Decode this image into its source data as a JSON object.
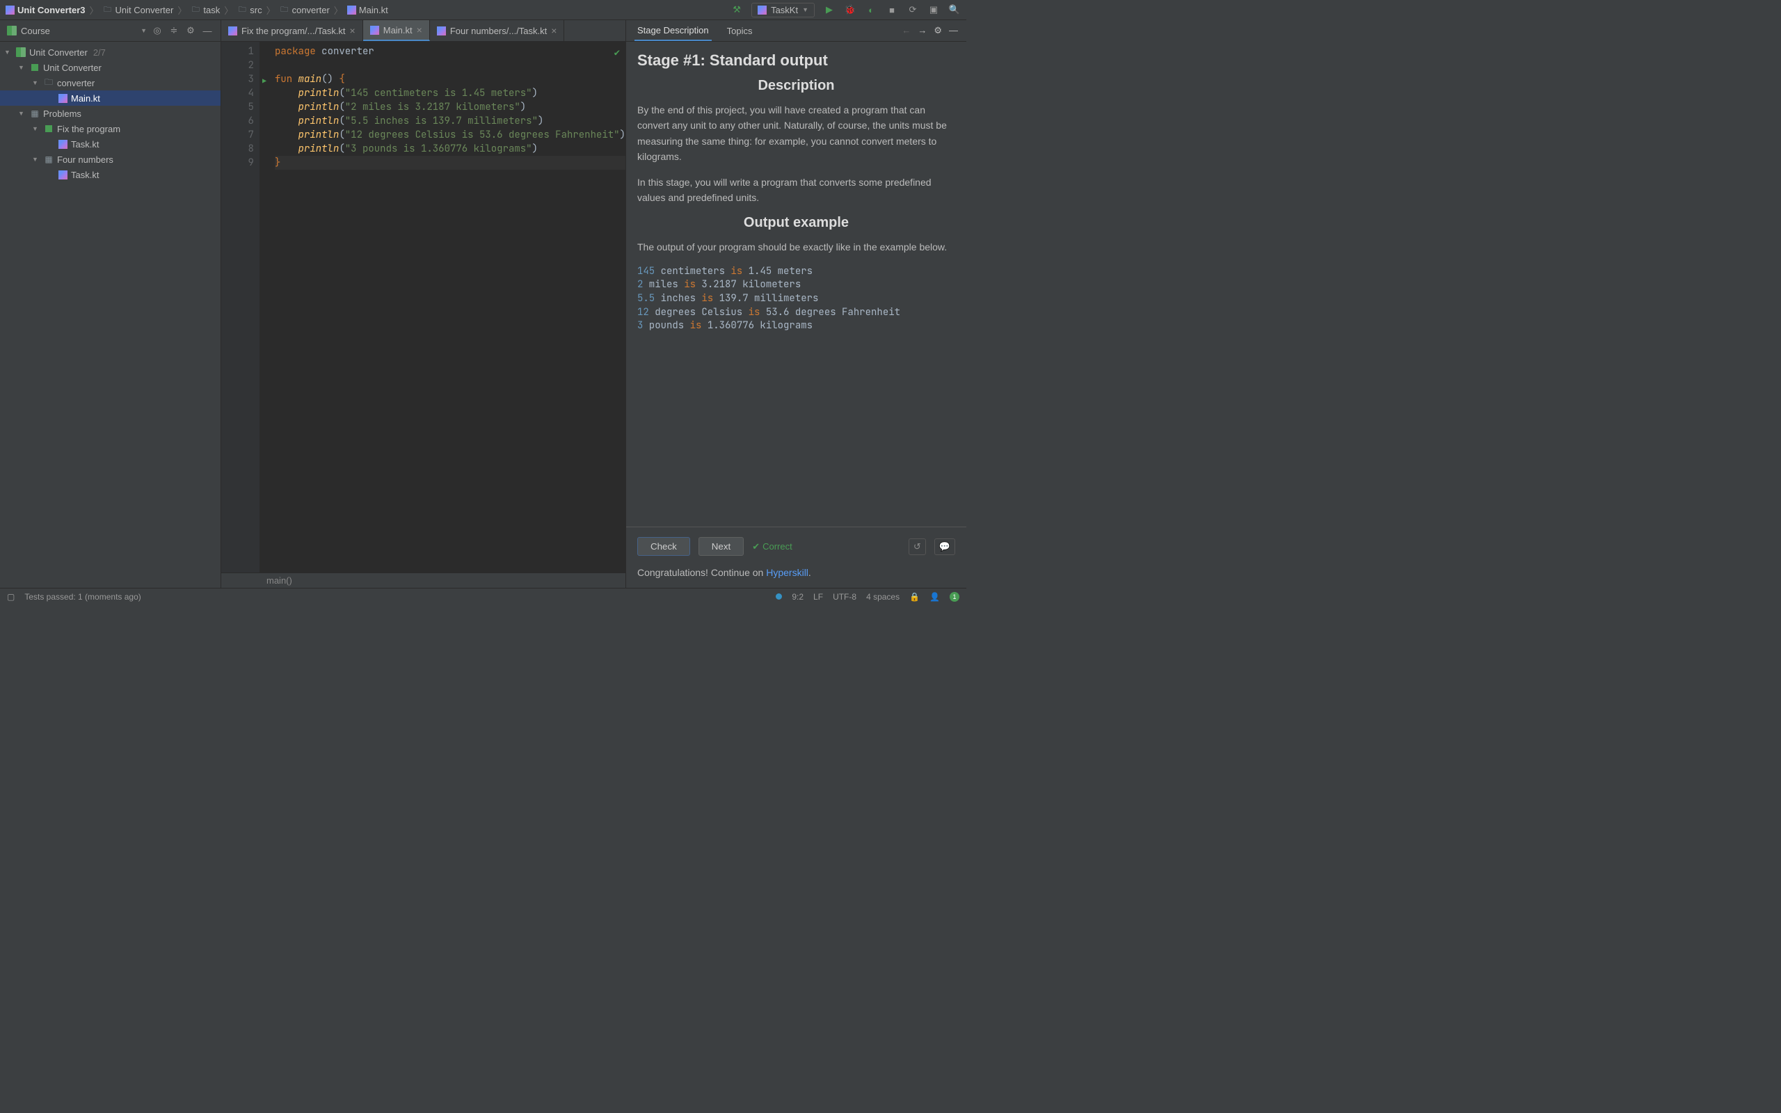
{
  "breadcrumbs": [
    {
      "label": "Unit Converter3",
      "bold": true
    },
    {
      "label": "Unit Converter"
    },
    {
      "label": "task"
    },
    {
      "label": "src"
    },
    {
      "label": "converter"
    },
    {
      "label": "Main.kt"
    }
  ],
  "run_config": "TaskKt",
  "sidebar": {
    "title": "Course",
    "tree": [
      {
        "depth": 0,
        "arrow": "▼",
        "icon": "book",
        "label": "Unit Converter",
        "count": "2/7"
      },
      {
        "depth": 1,
        "arrow": "▼",
        "icon": "green",
        "label": "Unit Converter"
      },
      {
        "depth": 2,
        "arrow": "▼",
        "icon": "folder",
        "label": "converter"
      },
      {
        "depth": 3,
        "arrow": "",
        "icon": "kotlin",
        "label": "Main.kt",
        "selected": true
      },
      {
        "depth": 1,
        "arrow": "▼",
        "icon": "module",
        "label": "Problems"
      },
      {
        "depth": 2,
        "arrow": "▼",
        "icon": "green",
        "label": "Fix the program"
      },
      {
        "depth": 3,
        "arrow": "",
        "icon": "kotlin",
        "label": "Task.kt"
      },
      {
        "depth": 2,
        "arrow": "▼",
        "icon": "module",
        "label": "Four numbers"
      },
      {
        "depth": 3,
        "arrow": "",
        "icon": "kotlin",
        "label": "Task.kt"
      }
    ]
  },
  "tabs": [
    {
      "label": "Fix the program/.../Task.kt"
    },
    {
      "label": "Main.kt",
      "active": true
    },
    {
      "label": "Four numbers/.../Task.kt"
    }
  ],
  "code": {
    "package_kw": "package",
    "package_name": " converter",
    "fun_kw": "fun",
    "main_name": " main",
    "parens": "() ",
    "lbrace": "{",
    "println": "println",
    "strings": [
      "\"145 centimeters is 1.45 meters\"",
      "\"2 miles is 3.2187 kilometers\"",
      "\"5.5 inches is 139.7 millimeters\"",
      "\"12 degrees Celsius is 53.6 degrees Fahrenheit\"",
      "\"3 pounds is 1.360776 kilograms\""
    ],
    "rbrace": "}"
  },
  "editor_footer": "main()",
  "desc": {
    "tab1": "Stage Description",
    "tab2": "Topics",
    "title": "Stage #1: Standard output",
    "h_desc": "Description",
    "p1": "By the end of this project, you will have created a program that can convert any unit to any other unit. Naturally, of course, the units must be measuring the same thing: for example, you cannot convert meters to kilograms.",
    "p2": "In this stage, you will write a program that converts some predefined values and predefined units.",
    "h_out": "Output example",
    "p3": "The output of your program should be exactly like in the example below.",
    "example": [
      {
        "n": "145",
        "t": " centimeters ",
        "k": "is",
        "rest": " 1.45 meters"
      },
      {
        "n": "2",
        "t": " miles ",
        "k": "is",
        "rest": " 3.2187 kilometers"
      },
      {
        "n": "5.5",
        "t": " inches ",
        "k": "is",
        "rest": " 139.7 millimeters"
      },
      {
        "n": "12",
        "t": " degrees Celsius ",
        "k": "is",
        "rest": " 53.6 degrees Fahrenheit"
      },
      {
        "n": "3",
        "t": " pounds ",
        "k": "is",
        "rest": " 1.360776 kilograms"
      }
    ],
    "check_btn": "Check",
    "next_btn": "Next",
    "correct": "Correct",
    "congrats_pre": "Congratulations! Continue on ",
    "congrats_link": "Hyperskill",
    "congrats_post": "."
  },
  "status": {
    "tests": "Tests passed: 1 (moments ago)",
    "pos": "9:2",
    "lf": "LF",
    "enc": "UTF-8",
    "indent": "4 spaces",
    "badge": "1"
  }
}
